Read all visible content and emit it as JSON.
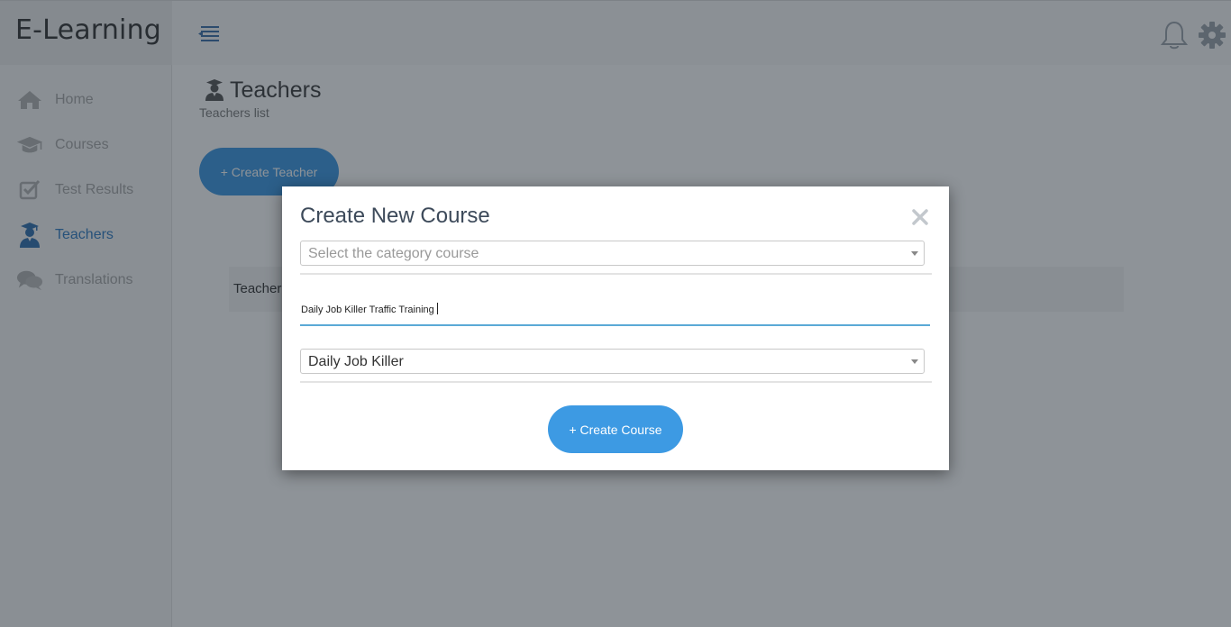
{
  "app": {
    "brand": "E-Learning"
  },
  "sidebar": {
    "items": [
      {
        "label": "Home",
        "icon": "home-icon",
        "active": false
      },
      {
        "label": "Courses",
        "icon": "graduation-cap-icon",
        "active": false
      },
      {
        "label": "Test Results",
        "icon": "checkbox-icon",
        "active": false
      },
      {
        "label": "Teachers",
        "icon": "teacher-icon",
        "active": true
      },
      {
        "label": "Translations",
        "icon": "chat-bubbles-icon",
        "active": false
      }
    ]
  },
  "page": {
    "title": "Teachers",
    "subtitle": "Teachers list",
    "create_button": "+ Create Teacher",
    "table_header_first": "Teacher"
  },
  "modal": {
    "title": "Create New Course",
    "category_placeholder": "Select the category course",
    "course_name_value": "Daily Job Killer Traffic Training",
    "course_select_value": "Daily Job Killer",
    "submit_label": "+ Create Course"
  },
  "colors": {
    "accent": "#3b97e2",
    "active_nav": "#2f7bc2",
    "input_underline": "#5aa9d6"
  }
}
